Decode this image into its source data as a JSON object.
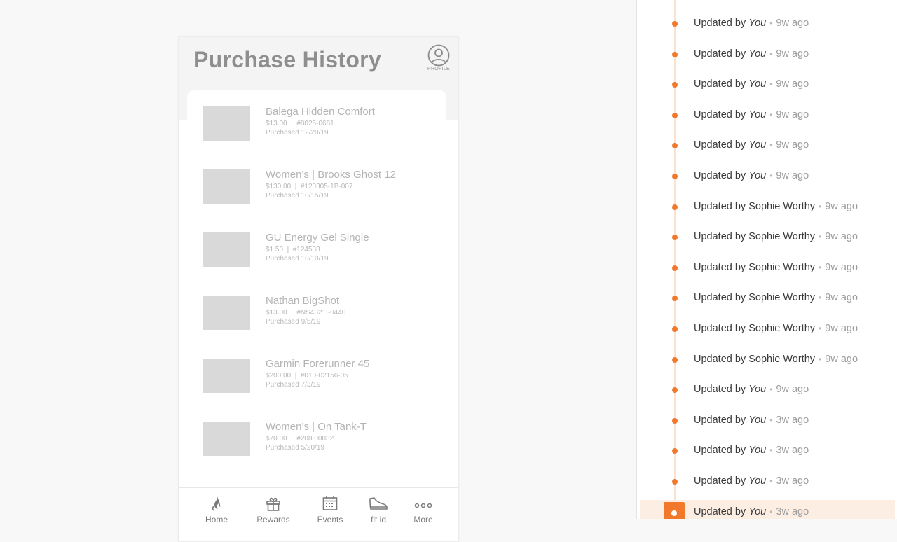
{
  "phone": {
    "title": "Purchase History",
    "profile_label": "PROFILE",
    "purchases": [
      {
        "name": "Balega Hidden Comfort",
        "price": "$13.00",
        "sku": "#8025-0681",
        "date": "Purchased 12/20/19"
      },
      {
        "name": "Women’s | Brooks Ghost 12",
        "price": "$130.00",
        "sku": "#120305-1B-007",
        "date": "Purchased 10/15/19"
      },
      {
        "name": "GU Energy Gel Single",
        "price": "$1.50",
        "sku": "#124538",
        "date": "Purchased 10/10/19"
      },
      {
        "name": "Nathan BigShot",
        "price": "$13.00",
        "sku": "#NS4321I-0440",
        "date": "Purchased 9/5/19"
      },
      {
        "name": "Garmin Forerunner 45",
        "price": "$200.00",
        "sku": "#010-02156-05",
        "date": "Purchased 7/3/19"
      },
      {
        "name": "Women’s | On Tank-T",
        "price": "$70.00",
        "sku": "#208.00032",
        "date": "Purchased 5/20/19"
      }
    ],
    "tabs": [
      {
        "label": "Home",
        "icon": "flame-icon"
      },
      {
        "label": "Rewards",
        "icon": "gift-icon"
      },
      {
        "label": "Events",
        "icon": "calendar-icon"
      },
      {
        "label": "fit id",
        "icon": "shoe-icon"
      },
      {
        "label": "More",
        "icon": "more-dots-icon"
      }
    ]
  },
  "activity": {
    "prefix": "Updated by",
    "entries": [
      {
        "who": "You",
        "when": "9w ago"
      },
      {
        "who": "You",
        "when": "9w ago"
      },
      {
        "who": "You",
        "when": "9w ago"
      },
      {
        "who": "You",
        "when": "9w ago"
      },
      {
        "who": "You",
        "when": "9w ago"
      },
      {
        "who": "You",
        "when": "9w ago"
      },
      {
        "who": "Sophie Worthy",
        "when": "9w ago"
      },
      {
        "who": "Sophie Worthy",
        "when": "9w ago"
      },
      {
        "who": "Sophie Worthy",
        "when": "9w ago"
      },
      {
        "who": "Sophie Worthy",
        "when": "9w ago"
      },
      {
        "who": "Sophie Worthy",
        "when": "9w ago"
      },
      {
        "who": "Sophie Worthy",
        "when": "9w ago"
      },
      {
        "who": "You",
        "when": "9w ago"
      },
      {
        "who": "You",
        "when": "3w ago"
      },
      {
        "who": "You",
        "when": "3w ago"
      },
      {
        "who": "You",
        "when": "3w ago"
      },
      {
        "who": "You",
        "when": "3w ago",
        "active": true
      }
    ]
  },
  "colors": {
    "accent": "#f2792b",
    "accent_light": "#fdeee4",
    "placeholder": "#d9d9d9"
  }
}
